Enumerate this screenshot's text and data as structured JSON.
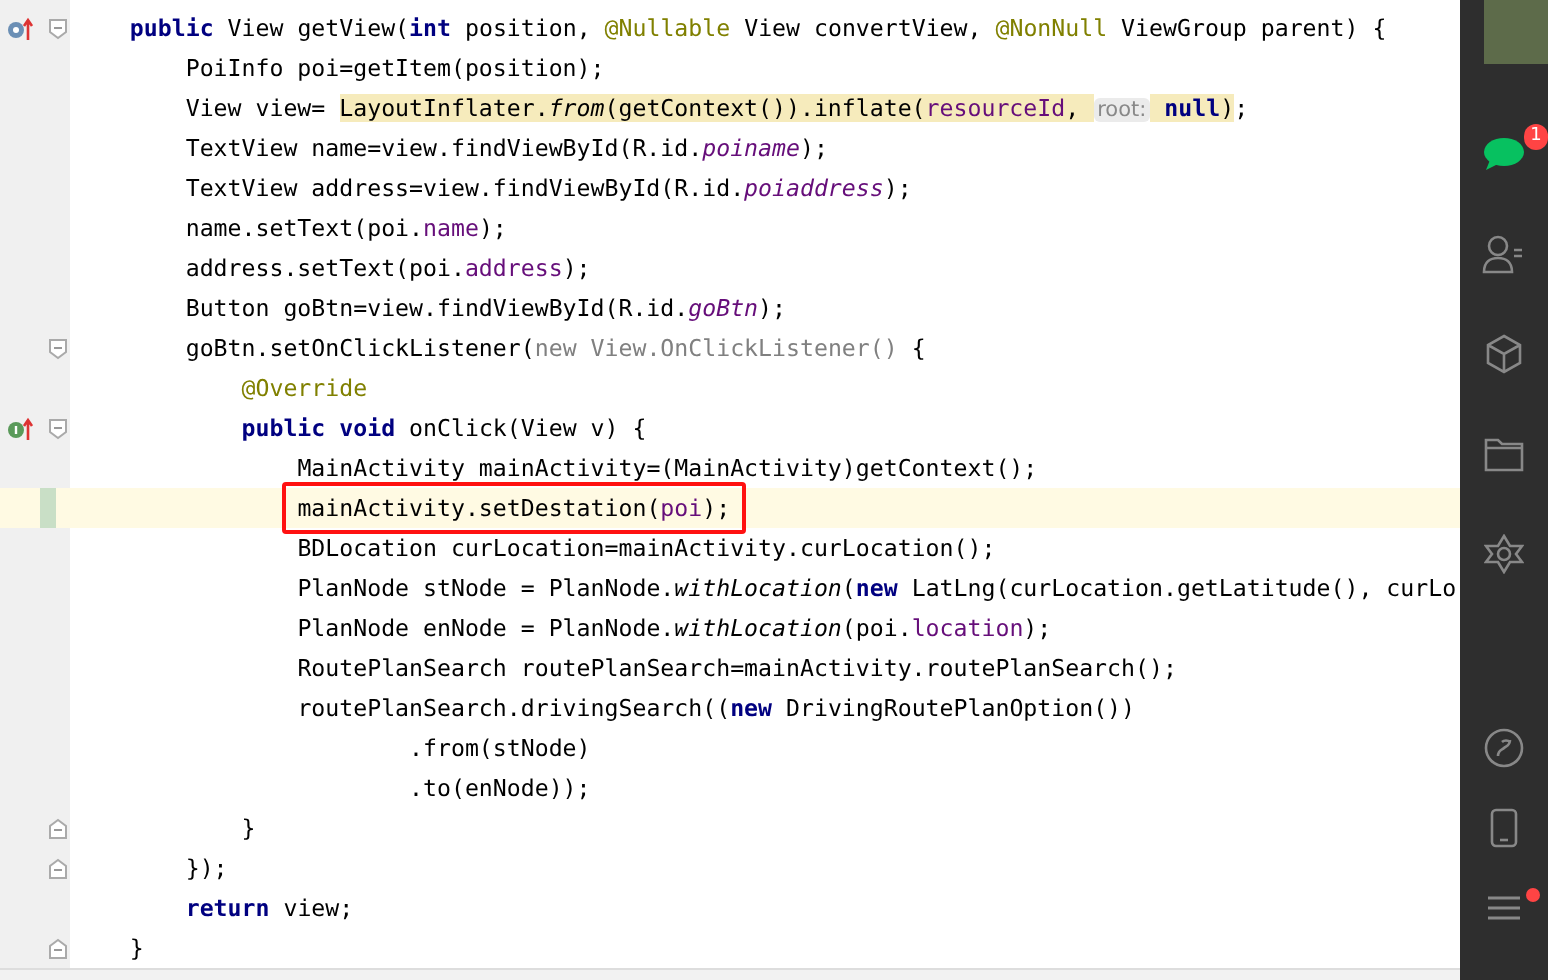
{
  "editor": {
    "lines": [
      {
        "gutter_icon": {
          "kind": "override"
        },
        "fold_marker": {
          "kind": "start"
        },
        "current": false,
        "changed": false,
        "marked": false,
        "tokens": [
          {
            "text": "    public",
            "kind": "keyword"
          },
          {
            "text": " View getView(",
            "kind": "plain"
          },
          {
            "text": "int",
            "kind": "keyword"
          },
          {
            "text": " position, ",
            "kind": "plain"
          },
          {
            "text": "@Nullable",
            "kind": "annotation"
          },
          {
            "text": " View convertView, ",
            "kind": "plain"
          },
          {
            "text": "@NonNull",
            "kind": "annotation"
          },
          {
            "text": " ViewGroup parent) {",
            "kind": "plain"
          }
        ]
      },
      {
        "current": false,
        "changed": false,
        "marked": false,
        "tokens": [
          {
            "text": "        PoiInfo poi=getItem(position);",
            "kind": "plain"
          }
        ]
      },
      {
        "current": false,
        "changed": false,
        "marked": false,
        "tokens": [
          {
            "text": "        View view= ",
            "kind": "plain",
            "highlighted": false
          },
          {
            "text": "LayoutInflater.",
            "kind": "plain",
            "highlighted": true
          },
          {
            "text": "from",
            "kind": "static",
            "highlighted": true
          },
          {
            "text": "(getContext()).inflate(",
            "kind": "plain",
            "highlighted": true
          },
          {
            "text": "resourceId",
            "kind": "field",
            "highlighted": true
          },
          {
            "text": ", ",
            "kind": "plain",
            "highlighted": true
          },
          {
            "text": "root:",
            "kind": "hint",
            "highlighted": true
          },
          {
            "text": " null",
            "kind": "keyword",
            "highlighted": true
          },
          {
            "text": ")",
            "kind": "plain",
            "highlighted": true
          },
          {
            "text": ";",
            "kind": "plain",
            "highlighted": false
          }
        ]
      },
      {
        "current": false,
        "changed": false,
        "marked": false,
        "tokens": [
          {
            "text": "        TextView name=view.findViewById(R.id.",
            "kind": "plain"
          },
          {
            "text": "poiname",
            "kind": "static-field"
          },
          {
            "text": ");",
            "kind": "plain"
          }
        ]
      },
      {
        "current": false,
        "changed": false,
        "marked": false,
        "tokens": [
          {
            "text": "        TextView address=view.findViewById(R.id.",
            "kind": "plain"
          },
          {
            "text": "poiaddress",
            "kind": "static-field"
          },
          {
            "text": ");",
            "kind": "plain"
          }
        ]
      },
      {
        "current": false,
        "changed": false,
        "marked": false,
        "tokens": [
          {
            "text": "        name.setText(poi.",
            "kind": "plain"
          },
          {
            "text": "name",
            "kind": "field"
          },
          {
            "text": ");",
            "kind": "plain"
          }
        ]
      },
      {
        "current": false,
        "changed": false,
        "marked": false,
        "tokens": [
          {
            "text": "        address.setText(poi.",
            "kind": "plain"
          },
          {
            "text": "address",
            "kind": "field"
          },
          {
            "text": ");",
            "kind": "plain"
          }
        ]
      },
      {
        "current": false,
        "changed": false,
        "marked": false,
        "tokens": [
          {
            "text": "        Button goBtn=view.findViewById(R.id.",
            "kind": "plain"
          },
          {
            "text": "goBtn",
            "kind": "static-field"
          },
          {
            "text": ");",
            "kind": "plain"
          }
        ]
      },
      {
        "fold_marker": {
          "kind": "start"
        },
        "current": false,
        "changed": false,
        "marked": false,
        "tokens": [
          {
            "text": "        goBtn.setOnClickListener(",
            "kind": "plain"
          },
          {
            "text": "new View.OnClickListener()",
            "kind": "anonymous"
          },
          {
            "text": " {",
            "kind": "plain"
          }
        ]
      },
      {
        "current": false,
        "changed": false,
        "marked": false,
        "tokens": [
          {
            "text": "            @Override",
            "kind": "annotation"
          }
        ]
      },
      {
        "gutter_icon": {
          "kind": "implement"
        },
        "fold_marker": {
          "kind": "start"
        },
        "current": false,
        "changed": false,
        "marked": false,
        "tokens": [
          {
            "text": "            public",
            "kind": "keyword"
          },
          {
            "text": " void",
            "kind": "keyword"
          },
          {
            "text": " onClick(View v) {",
            "kind": "plain"
          }
        ]
      },
      {
        "current": false,
        "changed": false,
        "marked": false,
        "tokens": [
          {
            "text": "                MainActivity mainActivity=(MainActivity)getContext();",
            "kind": "plain"
          }
        ]
      },
      {
        "current": true,
        "changed": true,
        "marked": true,
        "tokens": [
          {
            "text": "                mainActivity.setDestation(",
            "kind": "plain"
          },
          {
            "text": "poi",
            "kind": "field"
          },
          {
            "text": ");",
            "kind": "plain"
          }
        ]
      },
      {
        "current": false,
        "changed": false,
        "marked": false,
        "tokens": [
          {
            "text": "                BDLocation curLocation=mainActivity.curLocation();",
            "kind": "plain"
          }
        ]
      },
      {
        "current": false,
        "changed": false,
        "marked": false,
        "tokens": [
          {
            "text": "                PlanNode stNode = PlanNode.",
            "kind": "plain"
          },
          {
            "text": "withLocation",
            "kind": "static"
          },
          {
            "text": "(",
            "kind": "plain"
          },
          {
            "text": "new",
            "kind": "keyword"
          },
          {
            "text": " LatLng(curLocation.getLatitude(), curLo",
            "kind": "plain"
          }
        ]
      },
      {
        "current": false,
        "changed": false,
        "marked": false,
        "tokens": [
          {
            "text": "                PlanNode enNode = PlanNode.",
            "kind": "plain"
          },
          {
            "text": "withLocation",
            "kind": "static"
          },
          {
            "text": "(poi.",
            "kind": "plain"
          },
          {
            "text": "location",
            "kind": "field"
          },
          {
            "text": ");",
            "kind": "plain"
          }
        ]
      },
      {
        "current": false,
        "changed": false,
        "marked": false,
        "tokens": [
          {
            "text": "                RoutePlanSearch routePlanSearch=mainActivity.routePlanSearch();",
            "kind": "plain"
          }
        ]
      },
      {
        "current": false,
        "changed": false,
        "marked": false,
        "tokens": [
          {
            "text": "                routePlanSearch.drivingSearch((",
            "kind": "plain"
          },
          {
            "text": "new",
            "kind": "keyword"
          },
          {
            "text": " DrivingRoutePlanOption())",
            "kind": "plain"
          }
        ]
      },
      {
        "current": false,
        "changed": false,
        "marked": false,
        "tokens": [
          {
            "text": "                        .from(stNode)",
            "kind": "plain"
          }
        ]
      },
      {
        "current": false,
        "changed": false,
        "marked": false,
        "tokens": [
          {
            "text": "                        .to(enNode));",
            "kind": "plain"
          }
        ]
      },
      {
        "fold_marker": {
          "kind": "end"
        },
        "current": false,
        "changed": false,
        "marked": false,
        "tokens": [
          {
            "text": "            }",
            "kind": "plain"
          }
        ]
      },
      {
        "fold_marker": {
          "kind": "end"
        },
        "current": false,
        "changed": false,
        "marked": false,
        "tokens": [
          {
            "text": "        });",
            "kind": "plain"
          }
        ]
      },
      {
        "current": false,
        "changed": false,
        "marked": false,
        "tokens": [
          {
            "text": "        return",
            "kind": "keyword"
          },
          {
            "text": " view;",
            "kind": "plain"
          }
        ]
      },
      {
        "fold_marker": {
          "kind": "end"
        },
        "current": false,
        "changed": false,
        "marked": false,
        "tokens": [
          {
            "text": "    }",
            "kind": "plain"
          }
        ]
      }
    ]
  },
  "sidebar": {
    "items": [
      {
        "kind": "avatar"
      },
      {
        "kind": "chat",
        "badge": "1"
      },
      {
        "kind": "contacts"
      },
      {
        "kind": "cube"
      },
      {
        "kind": "folder"
      },
      {
        "kind": "atom"
      },
      {
        "kind": "link"
      },
      {
        "kind": "phone"
      },
      {
        "kind": "menu",
        "notification_dot": true
      }
    ]
  }
}
